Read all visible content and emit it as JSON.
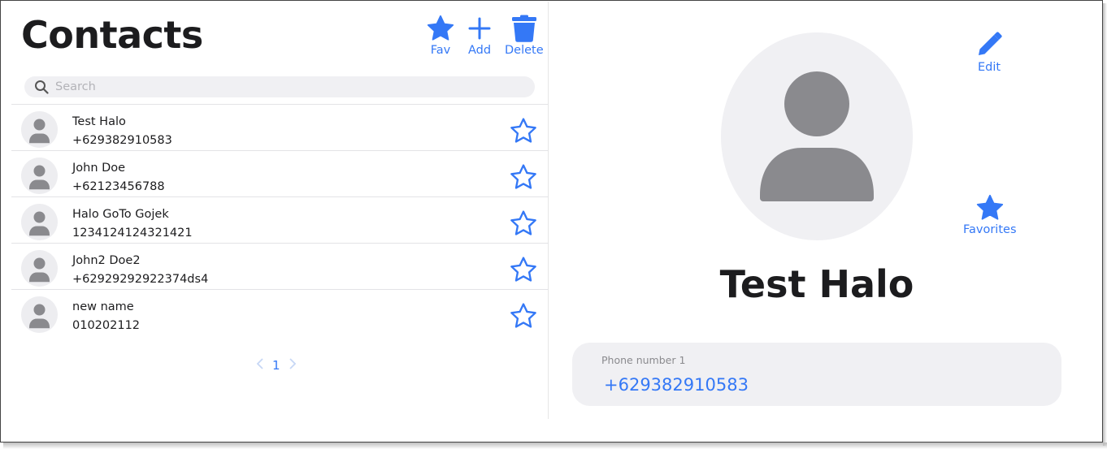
{
  "header": {
    "title": "Contacts",
    "actions": [
      {
        "id": "fav",
        "label": "Fav",
        "icon": "star-filled-icon"
      },
      {
        "id": "add",
        "label": "Add",
        "icon": "plus-icon"
      },
      {
        "id": "delete",
        "label": "Delete",
        "icon": "trash-icon"
      }
    ]
  },
  "search": {
    "placeholder": "Search",
    "value": "",
    "icon": "search-icon"
  },
  "contacts": [
    {
      "name": "Test Halo",
      "phone": "+629382910583",
      "favorite": false
    },
    {
      "name": "John Doe",
      "phone": "+62123456788",
      "favorite": false
    },
    {
      "name": "Halo GoTo Gojek",
      "phone": "1234124124321421",
      "favorite": false
    },
    {
      "name": "John2 Doe2",
      "phone": "+62929292922374ds4",
      "favorite": false
    },
    {
      "name": "new name",
      "phone": "010202112",
      "favorite": false
    }
  ],
  "pagination": {
    "current_page": "1",
    "prev_icon": "chevron-left-icon",
    "next_icon": "chevron-right-icon"
  },
  "detail": {
    "name": "Test Halo",
    "edit_label": "Edit",
    "favorites_label": "Favorites",
    "phone_label": "Phone number 1",
    "phone_value": "+629382910583"
  },
  "colors": {
    "accent": "#3478f6",
    "avatar_bg": "#f0f0f3",
    "avatar_figure": "#8a8a8e",
    "text": "#1c1c1e"
  }
}
